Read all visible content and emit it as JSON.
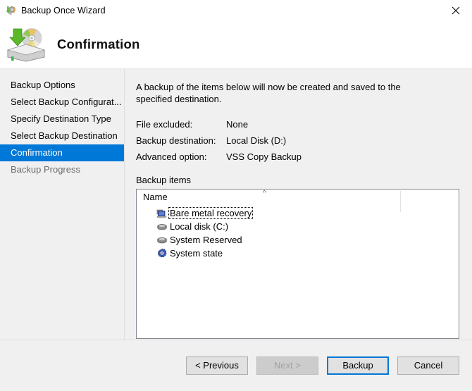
{
  "window": {
    "title": "Backup Once Wizard",
    "title_icon": "backup-wizard-icon",
    "close_icon": "close-icon"
  },
  "header": {
    "title": "Confirmation",
    "icon": "backup-disk-icon"
  },
  "sidebar": {
    "items": [
      {
        "label": "Backup Options",
        "state": "normal"
      },
      {
        "label": "Select Backup Configurat...",
        "state": "normal"
      },
      {
        "label": "Specify Destination Type",
        "state": "normal"
      },
      {
        "label": "Select Backup Destination",
        "state": "normal"
      },
      {
        "label": "Confirmation",
        "state": "selected"
      },
      {
        "label": "Backup Progress",
        "state": "disabled"
      }
    ],
    "selected_color": "#0078d7"
  },
  "main": {
    "intro": "A backup of the items below will now be created and saved to the specified destination.",
    "fields": [
      {
        "label": "File excluded:",
        "value": "None"
      },
      {
        "label": "Backup destination:",
        "value": "Local Disk (D:)"
      },
      {
        "label": "Advanced option:",
        "value": "VSS Copy Backup"
      }
    ],
    "items_label": "Backup items",
    "list": {
      "column_header": "Name",
      "sort_indicator": "^",
      "rows": [
        {
          "label": "Bare metal recovery",
          "icon": "computer-icon",
          "focused": true
        },
        {
          "label": "Local disk (C:)",
          "icon": "hard-disk-icon",
          "focused": false
        },
        {
          "label": "System Reserved",
          "icon": "hard-disk-icon",
          "focused": false
        },
        {
          "label": "System state",
          "icon": "system-gear-icon",
          "focused": false
        }
      ]
    }
  },
  "footer": {
    "buttons": [
      {
        "label": "< Previous",
        "state": "normal",
        "name": "previous-button"
      },
      {
        "label": "Next >",
        "state": "disabled",
        "name": "next-button"
      },
      {
        "label": "Backup",
        "state": "default",
        "name": "backup-button"
      },
      {
        "label": "Cancel",
        "state": "normal",
        "name": "cancel-button"
      }
    ]
  }
}
